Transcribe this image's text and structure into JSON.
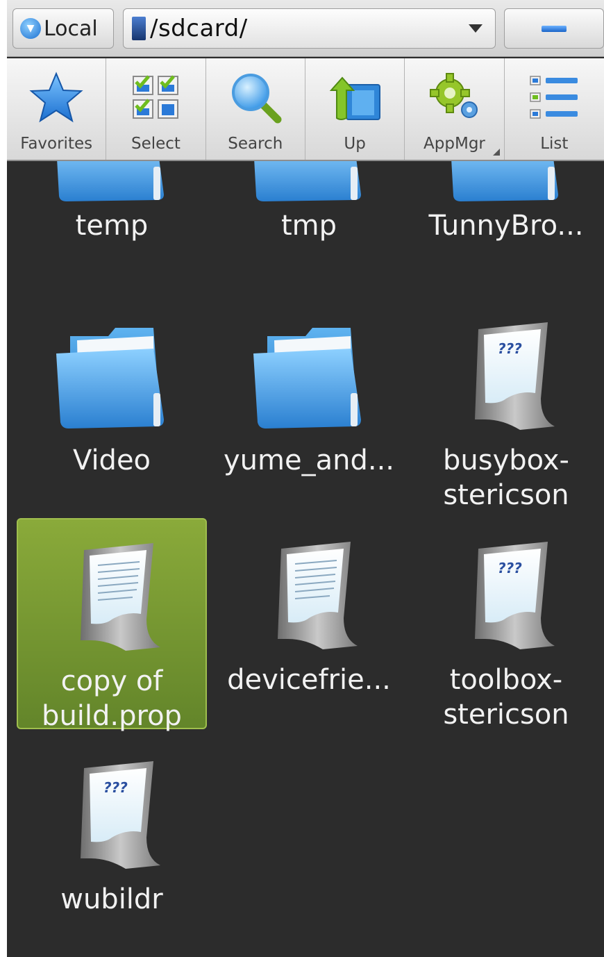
{
  "address_bar": {
    "location_label": "Local",
    "path": "/sdcard/",
    "collapse_label": "—"
  },
  "toolbar": {
    "items": [
      {
        "label": "Favorites",
        "icon": "star-icon"
      },
      {
        "label": "Select",
        "icon": "multi-select-icon"
      },
      {
        "label": "Search",
        "icon": "magnifier-icon"
      },
      {
        "label": "Up",
        "icon": "up-folder-icon"
      },
      {
        "label": "AppMgr",
        "icon": "gear-icon"
      },
      {
        "label": "List",
        "icon": "list-view-icon"
      }
    ]
  },
  "files": [
    {
      "name": "temp",
      "type": "folder"
    },
    {
      "name": "tmp",
      "type": "folder"
    },
    {
      "name": "TunnyBro...",
      "type": "folder"
    },
    {
      "name": "Video",
      "type": "folder"
    },
    {
      "name": "yume_and...",
      "type": "folder"
    },
    {
      "name_line1": "busybox-",
      "name_line2": "stericson",
      "type": "unknown-file"
    },
    {
      "name_line1": "copy of",
      "name_line2": "build.prop",
      "type": "text-file",
      "selected": true
    },
    {
      "name": "devicefrie...",
      "type": "text-file"
    },
    {
      "name_line1": "toolbox-",
      "name_line2": "stericson",
      "type": "unknown-file"
    },
    {
      "name": "wubildr",
      "type": "unknown-file"
    }
  ],
  "colors": {
    "background": "#2c2c2c",
    "selection": "#7a9a33",
    "folder_blue": "#3d97e0"
  }
}
